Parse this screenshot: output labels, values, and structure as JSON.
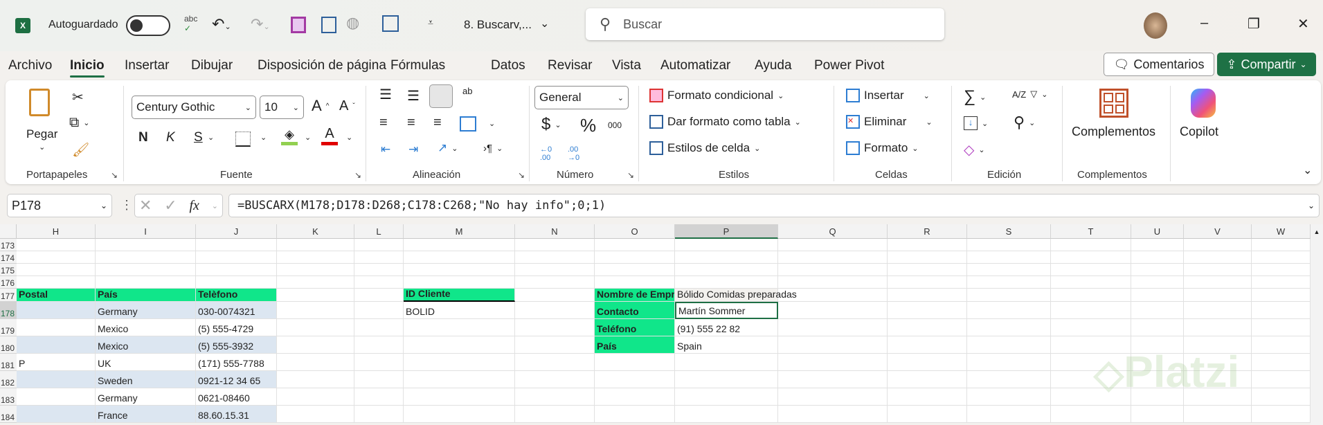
{
  "titlebar": {
    "autosave_label": "Autoguardado",
    "file_name": "8. Buscarv,...",
    "search_placeholder": "Buscar",
    "spell_label": "abc",
    "minimize": "–",
    "restore": "❐",
    "close": "✕"
  },
  "tabs": [
    "Archivo",
    "Inicio",
    "Insertar",
    "Dibujar",
    "Disposición de página",
    "Fórmulas",
    "Datos",
    "Revisar",
    "Vista",
    "Automatizar",
    "Ayuda",
    "Power Pivot"
  ],
  "active_tab": "Inicio",
  "actions": {
    "comments": "Comentarios",
    "share": "Compartir"
  },
  "ribbon": {
    "clipboard": {
      "paste": "Pegar",
      "label": "Portapapeles"
    },
    "font": {
      "name": "Century Gothic",
      "size": "10",
      "bold": "N",
      "italic": "K",
      "underline": "S",
      "grow": "A",
      "shrink": "A",
      "color_letter": "A",
      "label": "Fuente",
      "fill_color": "#92d050",
      "font_color": "#e00000"
    },
    "alignment": {
      "label": "Alineación",
      "wrap": "ab"
    },
    "number": {
      "format": "General",
      "currency": "$",
      "percent": "%",
      "thousands": "000",
      "inc_dec": "←0 .00",
      "dec_dec": ".00 →0",
      "label": "Número"
    },
    "styles": {
      "conditional": "Formato condicional",
      "as_table": "Dar formato como tabla",
      "cell_styles": "Estilos de celda",
      "label": "Estilos"
    },
    "cells": {
      "insert": "Insertar",
      "delete": "Eliminar",
      "format": "Formato",
      "label": "Celdas"
    },
    "editing": {
      "sum": "∑",
      "sort": "A/Z",
      "label": "Edición"
    },
    "addins": {
      "button": "Complementos",
      "label": "Complementos"
    },
    "copilot": {
      "button": "Copilot"
    }
  },
  "formula_bar": {
    "name_box": "P178",
    "fx": "fx",
    "formula": "=BUSCARX(M178;D178:D268;C178:C268;\"No hay info\";0;1)"
  },
  "sheet": {
    "columns": [
      "H",
      "I",
      "J",
      "K",
      "L",
      "M",
      "N",
      "O",
      "P",
      "Q",
      "R",
      "S",
      "T",
      "U",
      "V",
      "W"
    ],
    "rows": [
      "173",
      "174",
      "175",
      "176",
      "177",
      "178",
      "179",
      "180",
      "181",
      "182",
      "183",
      "184"
    ],
    "selected_col": "P",
    "selected_row": "178",
    "header_color": "#10e68a",
    "band_color": "#dce6f1",
    "cells": [
      {
        "r": "177",
        "c": "H",
        "v": "Postal",
        "s": "hdr"
      },
      {
        "r": "177",
        "c": "I",
        "v": "País",
        "s": "hdr"
      },
      {
        "r": "177",
        "c": "J",
        "v": "Telèfono",
        "s": "hdr"
      },
      {
        "r": "178",
        "c": "I",
        "v": "Germany"
      },
      {
        "r": "178",
        "c": "J",
        "v": "030-0074321"
      },
      {
        "r": "179",
        "c": "I",
        "v": "Mexico"
      },
      {
        "r": "179",
        "c": "J",
        "v": "(5) 555-4729"
      },
      {
        "r": "180",
        "c": "I",
        "v": "Mexico"
      },
      {
        "r": "180",
        "c": "J",
        "v": "(5) 555-3932"
      },
      {
        "r": "181",
        "c": "H",
        "v": "P"
      },
      {
        "r": "181",
        "c": "I",
        "v": "UK"
      },
      {
        "r": "181",
        "c": "J",
        "v": "(171) 555-7788"
      },
      {
        "r": "182",
        "c": "I",
        "v": "Sweden"
      },
      {
        "r": "182",
        "c": "J",
        "v": "0921-12 34 65"
      },
      {
        "r": "183",
        "c": "I",
        "v": "Germany"
      },
      {
        "r": "183",
        "c": "J",
        "v": "0621-08460"
      },
      {
        "r": "184",
        "c": "I",
        "v": "France"
      },
      {
        "r": "184",
        "c": "J",
        "v": "88.60.15.31"
      },
      {
        "r": "177",
        "c": "M",
        "v": "ID Cliente",
        "s": "hdrline"
      },
      {
        "r": "178",
        "c": "M",
        "v": "BOLID"
      },
      {
        "r": "177",
        "c": "O",
        "v": "Nombre de Empresa",
        "s": "hdr"
      },
      {
        "r": "178",
        "c": "O",
        "v": "Contacto",
        "s": "hdr"
      },
      {
        "r": "179",
        "c": "O",
        "v": "Teléfono",
        "s": "hdr"
      },
      {
        "r": "180",
        "c": "O",
        "v": "País",
        "s": "hdr"
      },
      {
        "r": "177",
        "c": "P",
        "v": "Bólido Comidas preparadas",
        "s": "over"
      },
      {
        "r": "178",
        "c": "P",
        "v": "Martín Sommer"
      },
      {
        "r": "179",
        "c": "P",
        "v": "(91) 555 22 82"
      },
      {
        "r": "180",
        "c": "P",
        "v": "Spain"
      }
    ]
  },
  "watermark": "Platzi"
}
